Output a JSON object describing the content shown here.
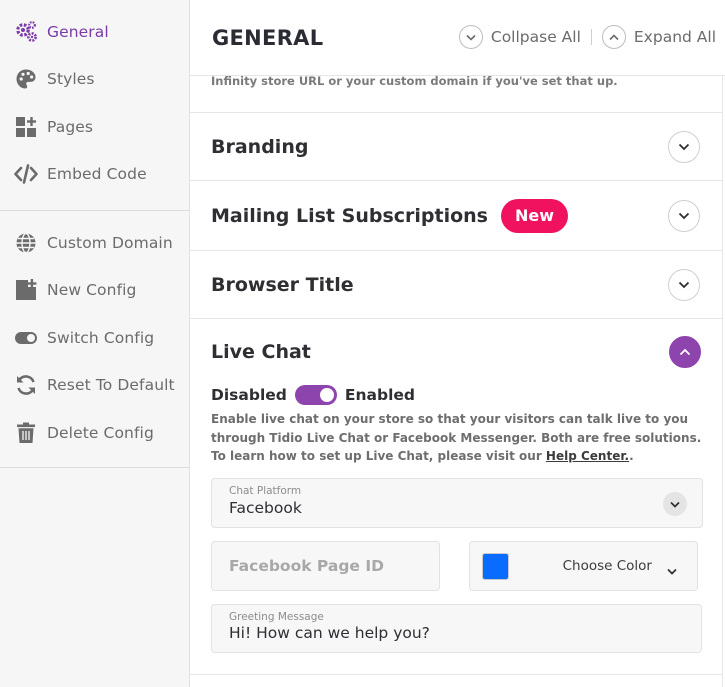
{
  "sidebar": {
    "items_primary": [
      {
        "label": "General",
        "icon": "gears-icon",
        "active": true
      },
      {
        "label": "Styles",
        "icon": "palette-icon"
      },
      {
        "label": "Pages",
        "icon": "pages-grid-icon"
      },
      {
        "label": "Embed Code",
        "icon": "code-icon"
      }
    ],
    "items_secondary": [
      {
        "label": "Custom Domain",
        "icon": "globe-icon"
      },
      {
        "label": "New Config",
        "icon": "new-config-icon"
      },
      {
        "label": "Switch Config",
        "icon": "toggle-icon"
      },
      {
        "label": "Reset To Default",
        "icon": "refresh-icon"
      },
      {
        "label": "Delete Config",
        "icon": "trash-icon"
      }
    ]
  },
  "header": {
    "title": "GENERAL",
    "collapse_label": "Collpase All",
    "expand_label": "Expand All"
  },
  "intro_text": "Infinity store URL or your custom domain if you've set that up.",
  "sections": [
    {
      "title": "Branding"
    },
    {
      "title": "Mailing List Subscriptions",
      "badge": "New"
    },
    {
      "title": "Browser Title"
    }
  ],
  "live_chat": {
    "title": "Live Chat",
    "toggle_off_label": "Disabled",
    "toggle_on_label": "Enabled",
    "enabled": true,
    "description": "Enable live chat on your store so that your visitors can talk live to you through Tidio Live Chat or Facebook Messenger. Both are free solutions. To learn how to set up Live Chat, please visit our ",
    "help_link": "Help Center.",
    "description_end": ".",
    "platform_label": "Chat Platform",
    "platform_value": "Facebook",
    "page_id_placeholder": "Facebook Page ID",
    "choose_color_label": "Choose Color",
    "selected_color": "#0a6cff",
    "greeting_label": "Greeting Message",
    "greeting_value": "Hi! How can we help you?"
  },
  "colors": {
    "accent": "#8e44ad",
    "badge": "#f0115f"
  }
}
